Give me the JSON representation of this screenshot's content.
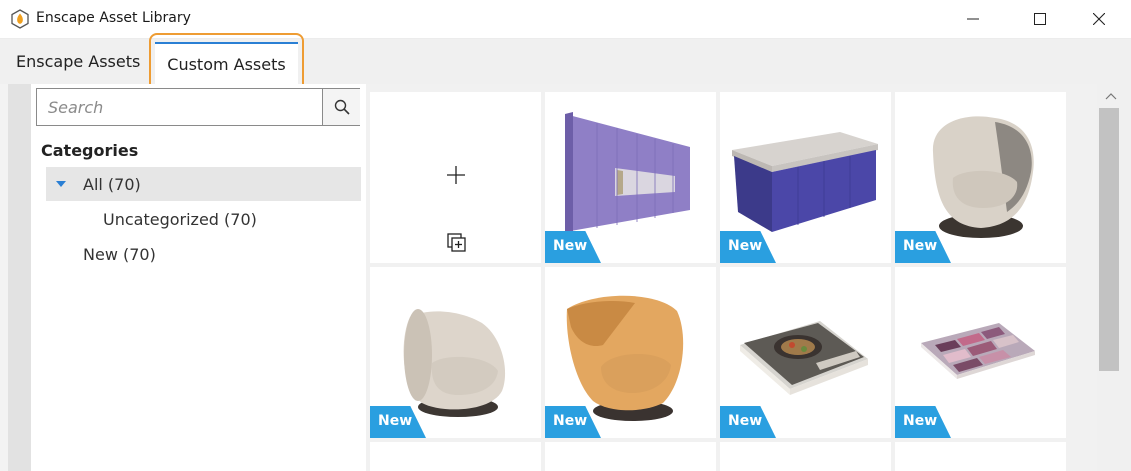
{
  "window": {
    "title": "Enscape Asset Library",
    "icon": "enscape-logo-icon",
    "controls": [
      "minimize-icon",
      "maximize-icon",
      "close-icon"
    ]
  },
  "tabs": [
    {
      "label": "Enscape Assets",
      "active": false
    },
    {
      "label": "Custom Assets",
      "active": true
    }
  ],
  "search": {
    "placeholder": "Search",
    "value": "",
    "icon": "search-icon"
  },
  "categories": {
    "title": "Categories",
    "items": [
      {
        "label": "All (70)",
        "expanded": true,
        "selected": true
      },
      {
        "label": "Uncategorized (70)",
        "selected": false
      },
      {
        "label": "New (70)",
        "selected": false
      }
    ]
  },
  "assets": {
    "add_tile": {
      "add_icon": "plus-icon",
      "import_icon": "add-multiple-icon"
    },
    "badge_color": "#2a9fe0",
    "items": [
      {
        "name": "purple-wall-cabinet",
        "badge": "New"
      },
      {
        "name": "kitchen-island",
        "badge": "New"
      },
      {
        "name": "armchair-grey-beige",
        "badge": "New"
      },
      {
        "name": "round-swivel-chair-beige",
        "badge": "New"
      },
      {
        "name": "swivel-chair-orange",
        "badge": "New"
      },
      {
        "name": "cookbook",
        "badge": "New"
      },
      {
        "name": "magazine",
        "badge": "New"
      }
    ]
  },
  "colors": {
    "accent": "#2a7fd4",
    "highlight": "#ee9c33",
    "badge": "#2a9fe0"
  }
}
